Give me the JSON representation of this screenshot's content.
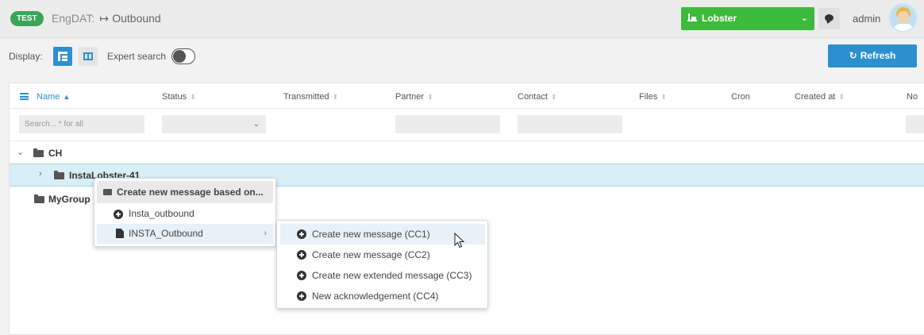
{
  "header": {
    "env_badge": "TEST",
    "app_name": "EngDAT:",
    "section": "Outbound",
    "instance": "Lobster",
    "user": "admin"
  },
  "toolbar": {
    "display_label": "Display:",
    "expert_search_label": "Expert search",
    "expert_search_on": false,
    "refresh_label": "Refresh"
  },
  "grid": {
    "columns": [
      "Name",
      "Status",
      "Transmitted",
      "Partner",
      "Contact",
      "Files",
      "Cron",
      "Created at",
      "No"
    ],
    "sorted_column": "Name",
    "search_placeholder": "Search... * for all",
    "rows": [
      {
        "label": "CH",
        "level": 0,
        "expanded": true
      },
      {
        "label": "InstaLobster-41",
        "level": 1,
        "expanded": false,
        "selected": true
      },
      {
        "label": "MyGroup",
        "level": 0
      }
    ]
  },
  "context_menu": {
    "title": "Create new message based on...",
    "items": [
      "Insta_outbound",
      "INSTA_Outbound"
    ],
    "submenu": [
      "Create new message (CC1)",
      "Create new message (CC2)",
      "Create new extended message (CC3)",
      "New acknowledgement (CC4)"
    ]
  },
  "colors": {
    "badge": "#3aa457",
    "lobster": "#3cba3c",
    "primary": "#2c8fcf",
    "selected_row": "#d9eef7"
  }
}
